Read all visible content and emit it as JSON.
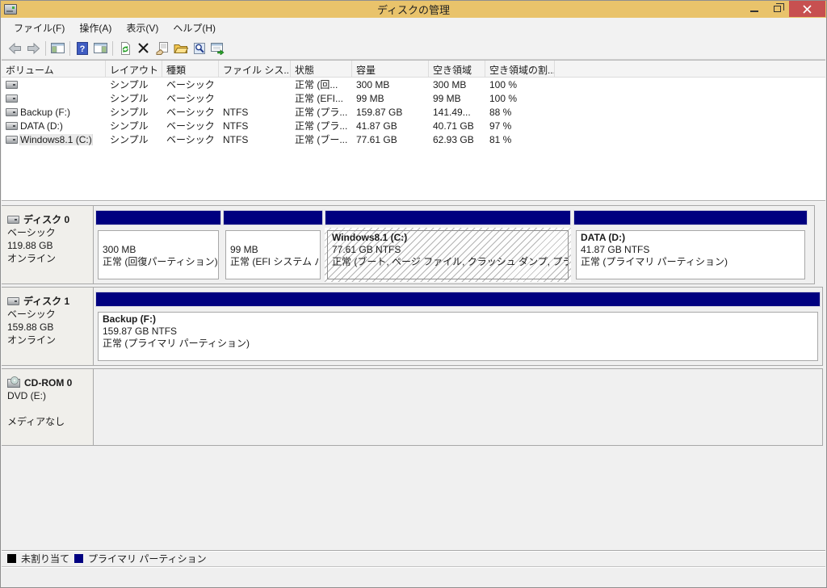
{
  "window": {
    "title": "ディスクの管理",
    "controls": {
      "minimize": "minimize",
      "restore": "restore",
      "close": "close"
    }
  },
  "menu": {
    "items": [
      "ファイル(F)",
      "操作(A)",
      "表示(V)",
      "ヘルプ(H)"
    ]
  },
  "toolbar": {
    "icons": [
      "back",
      "forward",
      "show-console-tree",
      "help",
      "show-action-pane",
      "refresh",
      "delete",
      "properties",
      "open",
      "find",
      "export-list"
    ]
  },
  "volume_table": {
    "columns": {
      "volume": "ボリューム",
      "layout": "レイアウト",
      "type": "種類",
      "fs": "ファイル シス...",
      "status": "状態",
      "capacity": "容量",
      "free": "空き領域",
      "free_pct": "空き領域の割..."
    },
    "rows": [
      {
        "volume": "",
        "layout": "シンプル",
        "type": "ベーシック",
        "fs": "",
        "status": "正常 (回...",
        "capacity": "300 MB",
        "free": "300 MB",
        "free_pct": "100 %"
      },
      {
        "volume": "",
        "layout": "シンプル",
        "type": "ベーシック",
        "fs": "",
        "status": "正常 (EFI...",
        "capacity": "99 MB",
        "free": "99 MB",
        "free_pct": "100 %"
      },
      {
        "volume": "Backup (F:)",
        "layout": "シンプル",
        "type": "ベーシック",
        "fs": "NTFS",
        "status": "正常 (プラ...",
        "capacity": "159.87 GB",
        "free": "141.49...",
        "free_pct": "88 %"
      },
      {
        "volume": "DATA (D:)",
        "layout": "シンプル",
        "type": "ベーシック",
        "fs": "NTFS",
        "status": "正常 (プラ...",
        "capacity": "41.87 GB",
        "free": "40.71 GB",
        "free_pct": "97 %"
      },
      {
        "volume": "Windows8.1 (C:)",
        "layout": "シンプル",
        "type": "ベーシック",
        "fs": "NTFS",
        "status": "正常 (ブー...",
        "capacity": "77.61 GB",
        "free": "62.93 GB",
        "free_pct": "81 %"
      }
    ]
  },
  "disks": [
    {
      "name": "ディスク 0",
      "type": "ベーシック",
      "size": "119.88 GB",
      "status": "オンライン",
      "partitions": [
        {
          "name": "",
          "line2": "300 MB",
          "line3": "正常 (回復パーティション)"
        },
        {
          "name": "",
          "line2": "99 MB",
          "line3": "正常 (EFI システム パ"
        },
        {
          "name": "Windows8.1  (C:)",
          "line2": "77.61 GB NTFS",
          "line3": "正常 (ブート, ページ ファイル, クラッシュ ダンプ, プライマリ パー"
        },
        {
          "name": "DATA  (D:)",
          "line2": "41.87 GB NTFS",
          "line3": "正常 (プライマリ パーティション)"
        }
      ]
    },
    {
      "name": "ディスク 1",
      "type": "ベーシック",
      "size": "159.88 GB",
      "status": "オンライン",
      "partitions": [
        {
          "name": "Backup  (F:)",
          "line2": "159.87 GB NTFS",
          "line3": "正常 (プライマリ パーティション)"
        }
      ]
    }
  ],
  "cdrom": {
    "name": "CD-ROM 0",
    "drive": "DVD (E:)",
    "media": "メディアなし"
  },
  "legend": {
    "unallocated": {
      "label": "未割り当て",
      "color": "#000000"
    },
    "primary": {
      "label": "プライマリ パーティション",
      "color": "#000080"
    }
  },
  "colors": {
    "titlebar": "#e9c36b",
    "close_button": "#c75050",
    "partition_primary": "#000080"
  }
}
